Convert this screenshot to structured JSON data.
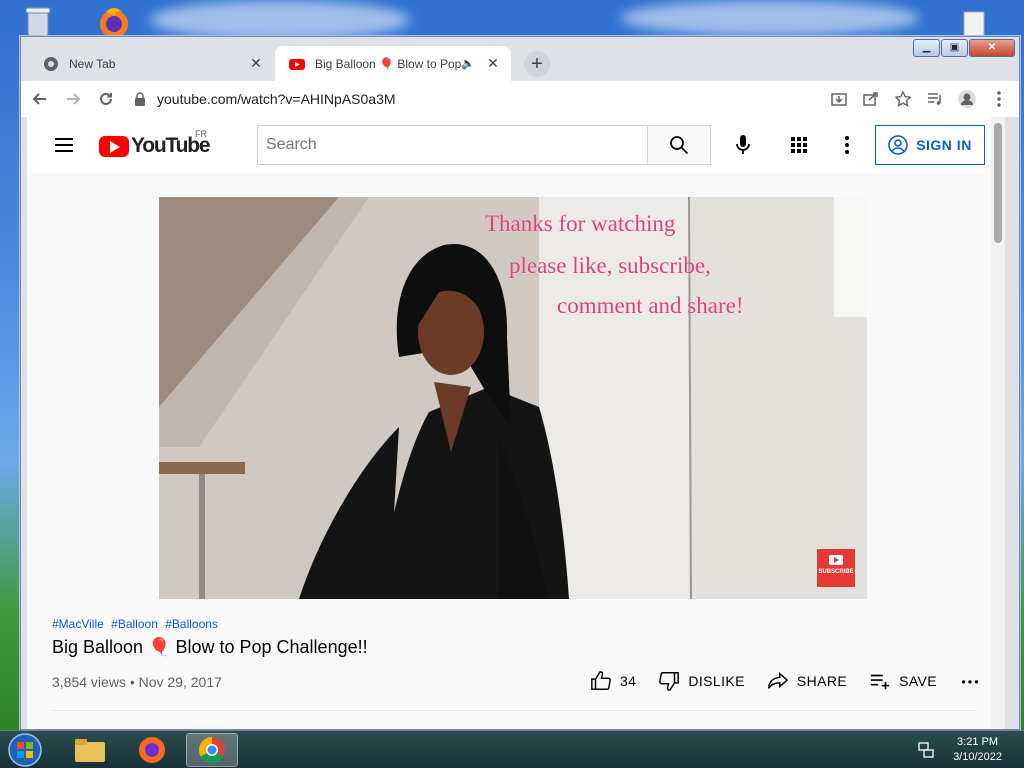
{
  "browser": {
    "tabs": [
      {
        "title": "New Tab",
        "active": false
      },
      {
        "title": "Big Balloon 🎈 Blow to Pop C",
        "active": true
      }
    ],
    "url": "youtube.com/watch?v=AHINpAS0a3M",
    "new_tab_label": "+"
  },
  "youtube": {
    "logo_text": "YouTube",
    "country_code": "FR",
    "search_placeholder": "Search",
    "sign_in_label": "SIGN IN"
  },
  "video": {
    "overlay_lines": [
      "Thanks for watching",
      "please like, subscribe,",
      "comment and share!"
    ],
    "subscribe_badge": "SUBSCRIBE",
    "hashtags": [
      "#MacVille",
      "#Balloon",
      "#Balloons"
    ],
    "title": "Big Balloon 🎈 Blow to Pop Challenge!!",
    "meta": "3,854 views • Nov 29, 2017",
    "likes": "34",
    "dislike_label": "DISLIKE",
    "share_label": "SHARE",
    "save_label": "SAVE"
  },
  "taskbar": {
    "time": "3:21 PM",
    "date": "3/10/2022"
  },
  "colors": {
    "yt_red": "#ff0000",
    "link_blue": "#065fd4",
    "overlay_pink": "#e0407f"
  }
}
